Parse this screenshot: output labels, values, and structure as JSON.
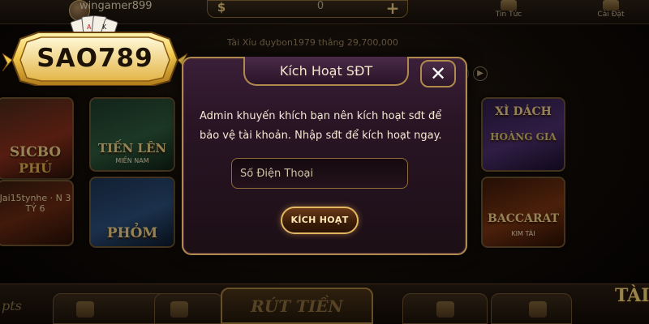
{
  "header": {
    "username": "wingamer899",
    "balance": "0",
    "news_label": "Tin Tức",
    "settings_label": "Cài Đặt"
  },
  "ticker": "Tài Xỉu đụybon1979 thắng 29,700,000",
  "logo": {
    "text": "SAO789"
  },
  "games": [
    {
      "label_1": "SICBO",
      "label_2": "PHÚ",
      "sub": "Jai15tynhe · N 3 TỶ 6"
    },
    {
      "label_1": "TIẾN LÊN",
      "sub": "MIỀN NAM"
    },
    {
      "label_1": "PHỎM"
    },
    {
      "label_1": "XÌ DÁCH",
      "label_2": "HOÀNG GIA"
    },
    {
      "label_1": "BACCARAT",
      "sub": "KIM TÀI"
    }
  ],
  "bottom": {
    "withdraw_label": "RÚT TIỀN",
    "tai_label": "TÀI",
    "pts_label": "pts"
  },
  "modal": {
    "title": "Kích Hoạt SĐT",
    "message": "Admin khuyến khích bạn nên kích hoạt sđt để bảo vệ tài khoản. Nhập sđt để kích hoạt ngay.",
    "phone_placeholder": "Số Điện Thoại",
    "phone_value": "",
    "activate_label": "KÍCH HOẠT",
    "close_symbol": "✕"
  },
  "colors": {
    "gold": "#b08a4c",
    "modal_bg": "#2a1526",
    "accent": "#e3b662"
  }
}
